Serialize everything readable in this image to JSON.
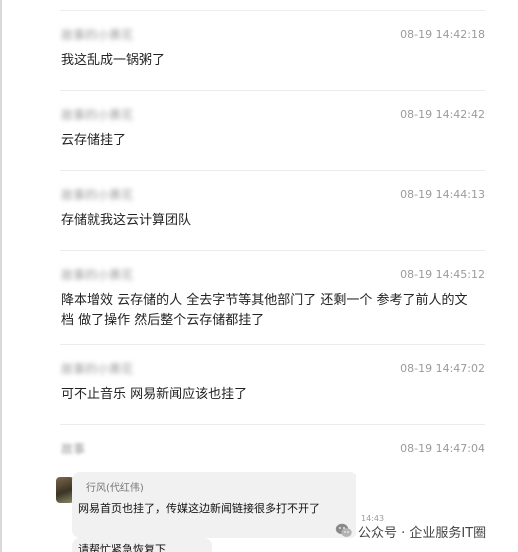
{
  "comments": [
    {
      "name": "故事的小黄花",
      "time": "08-19 14:42:18",
      "text": "我这乱成一锅粥了"
    },
    {
      "name": "故事的小黄花",
      "time": "08-19 14:42:42",
      "text": "云存储挂了"
    },
    {
      "name": "故事的小黄花",
      "time": "08-19 14:44:13",
      "text": "存储就我这云计算团队"
    },
    {
      "name": "故事的小黄花",
      "time": "08-19 14:45:12",
      "text": "降本增效 云存储的人 全去字节等其他部门了 还剩一个 参考了前人的文档 做了操作 然后整个云存储都挂了"
    },
    {
      "name": "故事的小黄花",
      "time": "08-19 14:47:02",
      "text": "可不止音乐 网易新闻应该也挂了"
    },
    {
      "name": "故事",
      "time": "08-19 14:47:04",
      "text": ""
    }
  ],
  "screenshot": {
    "sender": "行风(代红伟)",
    "message": "网易首页也挂了，传媒这边新闻链接很多打不开了",
    "message_2": "请帮忙紧急恢复下",
    "time": "14:43"
  },
  "watermark": {
    "text": "公众号 · 企业服务IT圈"
  },
  "icons": {
    "watermark": "wechat-icon",
    "avatar": "avatar-icon"
  }
}
